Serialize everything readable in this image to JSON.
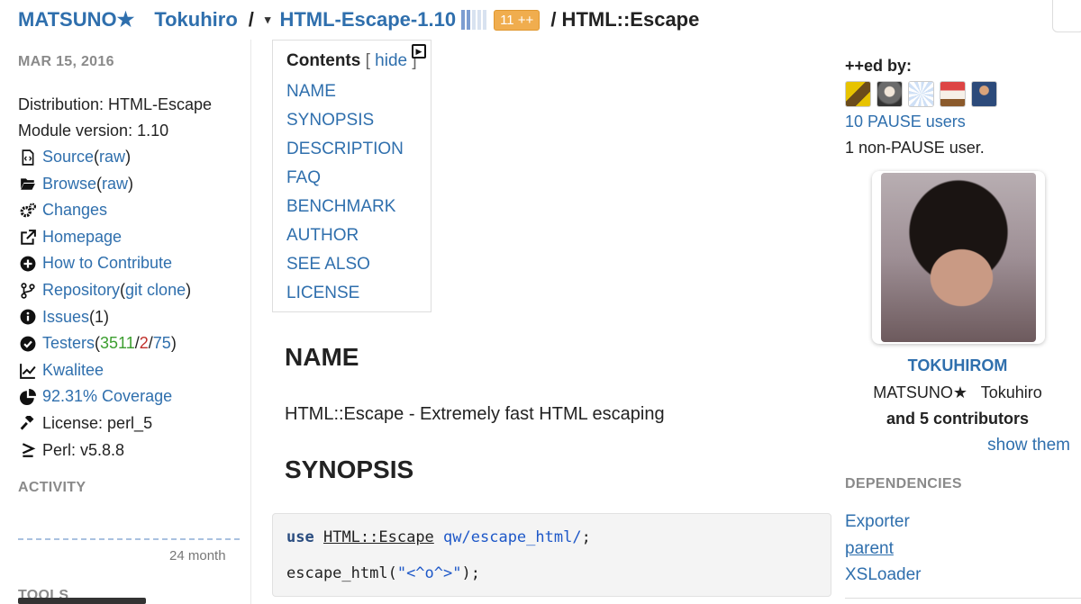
{
  "breadcrumb": {
    "author_family": "MATSUNO★",
    "author_given": "Tokuhiro",
    "separator": "/",
    "dropdown_glyph": "▾",
    "distribution": "HTML-Escape-1.10",
    "plusplus_badge": "11 ++",
    "module_path": "/ HTML::Escape"
  },
  "sidebar": {
    "date": "MAR 15, 2016",
    "distribution_label": "Distribution: HTML-Escape",
    "module_version_label": "Module version: 1.10",
    "source": {
      "label": "Source",
      "extra_open": " (",
      "extra": "raw",
      "extra_close": ")"
    },
    "browse": {
      "label": "Browse",
      "extra_open": " (",
      "extra": "raw",
      "extra_close": ")"
    },
    "changes": "Changes",
    "homepage": "Homepage",
    "how_to_contribute": "How to Contribute",
    "repository": {
      "label": "Repository",
      "extra_open": " (",
      "extra": "git clone",
      "extra_close": ")"
    },
    "issues": {
      "label": "Issues",
      "count": " (1)"
    },
    "testers": {
      "label": "Testers",
      "open": " (",
      "pass": "3511",
      "sep1": " / ",
      "fail": "2",
      "sep2": " / ",
      "na": "75",
      "close": ")"
    },
    "kwalitee": "Kwalitee",
    "coverage": "92.31% Coverage",
    "license": "License: perl_5",
    "perl": "Perl: v5.8.8",
    "activity_title": "ACTIVITY",
    "activity_period": "24 month",
    "tools_title": "TOOLS"
  },
  "toc": {
    "title": "Contents",
    "bracket_open": " [ ",
    "hide": "hide",
    "bracket_close": " ]",
    "items": [
      "NAME",
      "SYNOPSIS",
      "DESCRIPTION",
      "FAQ",
      "BENCHMARK",
      "AUTHOR",
      "SEE ALSO",
      "LICENSE"
    ]
  },
  "main": {
    "name_heading": "NAME",
    "name_text": "HTML::Escape - Extremely fast HTML escaping",
    "synopsis_heading": "SYNOPSIS",
    "code": {
      "line1_kw": "use",
      "line1_module": "HTML::Escape",
      "line1_qw": "qw/escape_html/",
      "line1_end": ";",
      "line2_fn": "escape_html(",
      "line2_str": "\"<^o^>\"",
      "line2_end": ");"
    }
  },
  "right": {
    "plusplus_title": "++ed by:",
    "pause_users": "10 PAUSE users",
    "non_pause": "1 non-PAUSE user.",
    "author_id": "TOKUHIROM",
    "author_name": "MATSUNO★   Tokuhiro",
    "contributors": "and 5 contributors",
    "show_them": "show them",
    "dependencies_title": "DEPENDENCIES",
    "dependencies": [
      "Exporter",
      "parent",
      "XSLoader"
    ]
  },
  "colors": {
    "link": "#2f6fad",
    "badge": "#f0ad4e",
    "pass": "#3c9e2f",
    "fail": "#c0302b",
    "section_title": "#8a8a8a"
  },
  "icons": {
    "source": "file-code-icon",
    "browse": "folder-open-icon",
    "changes": "gears-icon",
    "homepage": "external-link-icon",
    "contribute": "plus-circle-icon",
    "repository": "code-branch-icon",
    "issues": "info-circle-icon",
    "testers": "check-circle-icon",
    "kwalitee": "line-chart-icon",
    "coverage": "pie-chart-icon",
    "license": "gavel-icon",
    "perl": "greater-equal-icon"
  }
}
